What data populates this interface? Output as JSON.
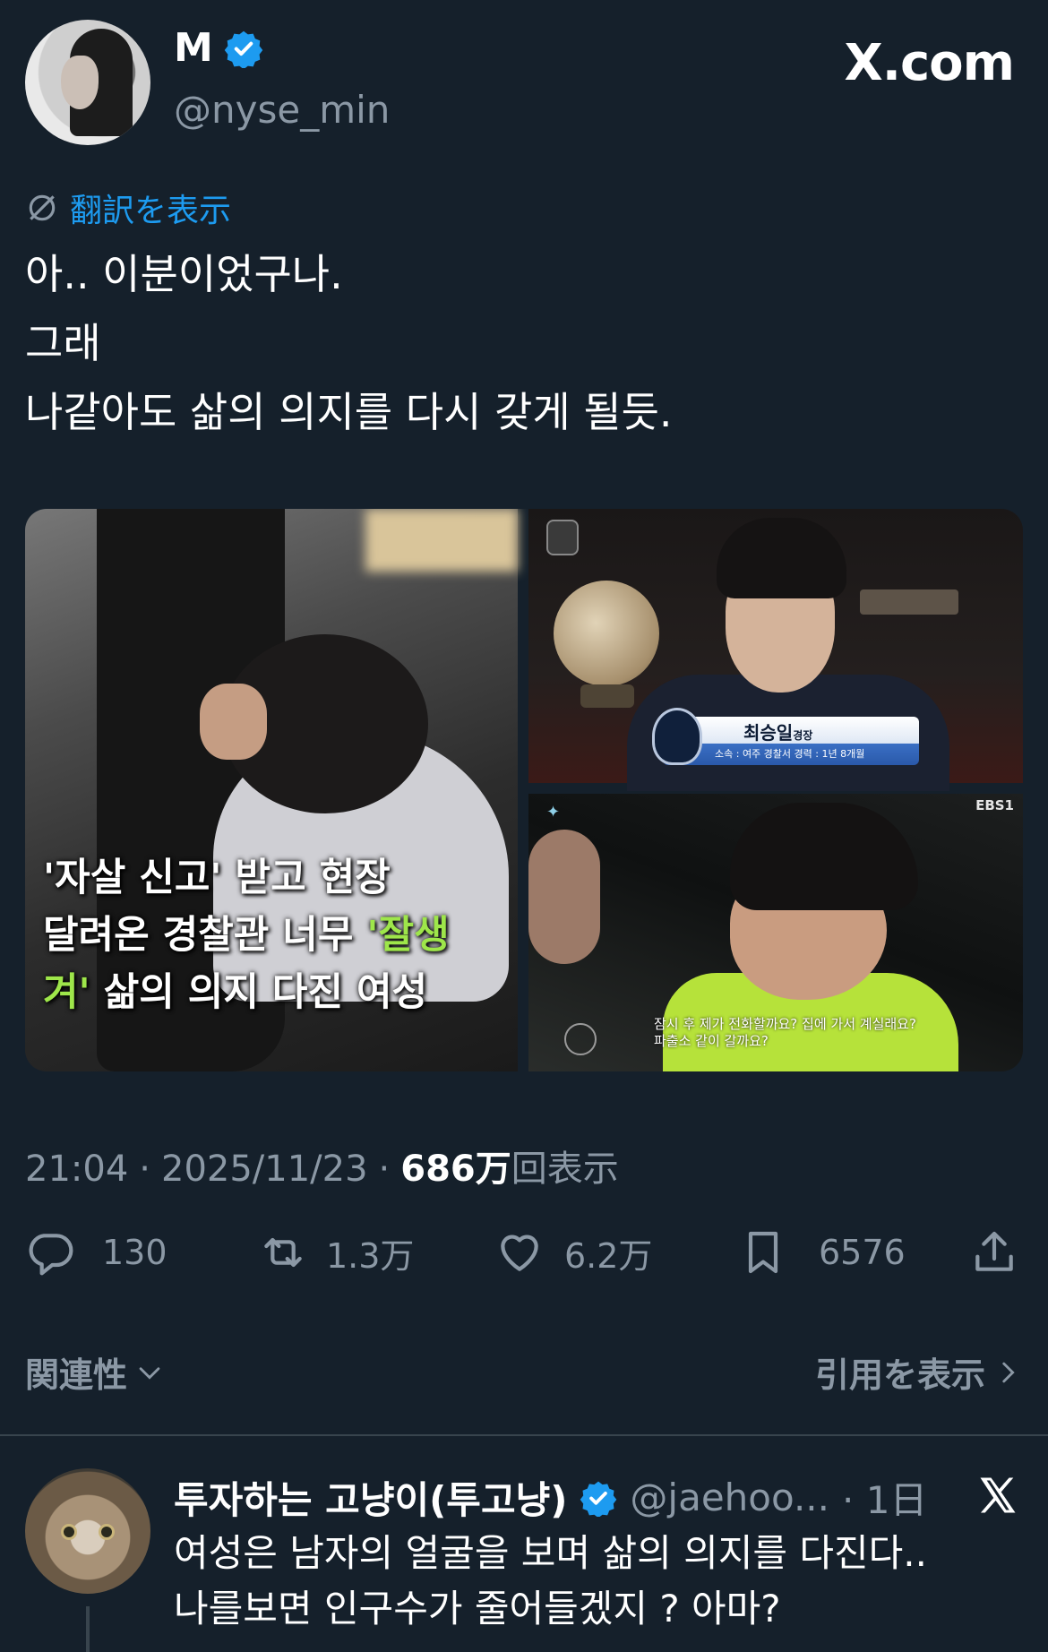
{
  "author": {
    "display_name": "M",
    "handle": "@nyse_min",
    "verified": true
  },
  "brand": "X.com",
  "translate_label": "翻訳を表示",
  "tweet_lines": [
    "아.. 이분이었구나.",
    "그래",
    "나같아도 삶의 의지를 다시 갖게 될듯."
  ],
  "media": {
    "left_caption": {
      "line1": "'자살 신고' 받고 현장",
      "line2_prefix": "달려온 경찰관 너무 ",
      "line2_highlight": "'잘생",
      "line3_highlight": "겨'",
      "line3_suffix": " 삶의 의지 다진 여성"
    },
    "name_plate": {
      "name": "최승일",
      "rank": "경장",
      "sub": "소속 : 여주 경찰서   경력 : 1년 8개월"
    },
    "bottom_right": {
      "channel": "EBS1",
      "subtitle_line1": "잠시 후 제가 전화할까요? 집에 가서 계실래요?",
      "subtitle_line2": "파출소 같이 갈까요?"
    }
  },
  "meta": {
    "time": "21:04",
    "date": "2025/11/23",
    "separator": "·",
    "views": "686万",
    "views_label": "回表示"
  },
  "actions": {
    "replies": "130",
    "reposts": "1.3万",
    "likes": "6.2万",
    "bookmarks": "6576"
  },
  "sort": {
    "relevance_label": "関連性",
    "quotes_label": "引用を表示"
  },
  "reply": {
    "display_name": "투자하는 고냥이(투고냥)",
    "handle": "@jaehoo...",
    "time": "· 1日",
    "text_line1": "여성은 남자의 얼굴을 보며 삶의 의지를 다진다..",
    "text_line2": "나를보면 인구수가 줄어들겠지 ? 아마?"
  },
  "colors": {
    "background": "#15202b",
    "accent": "#1d9bf0",
    "muted": "#8b98a5",
    "divider": "#38444d",
    "highlight": "#9ee64a"
  }
}
